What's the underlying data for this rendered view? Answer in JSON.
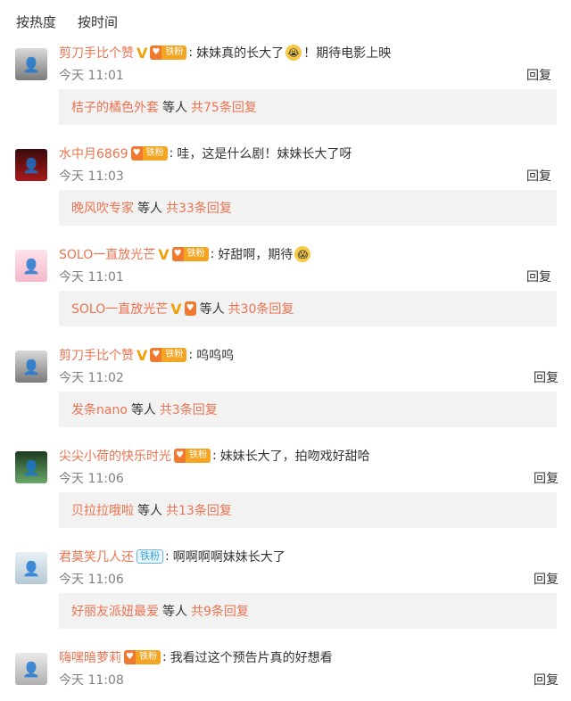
{
  "tabs": {
    "hot": "按热度",
    "time": "按时间"
  },
  "fan_badge": {
    "icon": "♥",
    "text": "铁粉"
  },
  "comments": [
    {
      "user": "剪刀手比个赞",
      "verified": true,
      "fan": true,
      "text": "妹妹真的长大了",
      "emoji": "😭",
      "after": "！期待电影上映",
      "time": "今天 11:01",
      "reply": "回复",
      "sub_user": "桔子的橘色外套",
      "sub_mid": "等人",
      "sub_count": "共75条回复"
    },
    {
      "user": "水中月6869",
      "verified": false,
      "fan": true,
      "text": "哇，这是什么剧！妹妹长大了呀",
      "emoji": "",
      "after": "",
      "time": "今天 11:03",
      "reply": "回复",
      "sub_user": "晚风吹专家",
      "sub_mid": "等人",
      "sub_count": "共33条回复"
    },
    {
      "user": "SOLO一直放光芒",
      "verified": true,
      "fan": true,
      "text": "好甜啊，期待",
      "emoji": "😱",
      "after": "",
      "time": "今天 11:01",
      "reply": "回复",
      "sub_user": "SOLO一直放光芒",
      "sub_mid": "等人",
      "sub_count": "共30条回复"
    },
    {
      "user": "剪刀手比个赞",
      "verified": true,
      "fan": true,
      "text": "呜呜呜",
      "emoji": "",
      "after": "",
      "time": "今天 11:02",
      "reply": "回复",
      "sub_user": "发条nano",
      "sub_mid": "等人",
      "sub_count": "共3条回复"
    },
    {
      "user": "尖尖小荷的快乐时光",
      "verified": false,
      "fan": true,
      "text": "妹妹长大了，拍吻戏好甜哈",
      "emoji": "",
      "after": "",
      "time": "今天 11:06",
      "reply": "回复",
      "sub_user": "贝拉拉哦啦",
      "sub_mid": "等人",
      "sub_count": "共13条回复"
    },
    {
      "user": "君莫笑几人还",
      "verified": false,
      "fan": true,
      "text": "啊啊啊啊妹妹长大了",
      "emoji": "",
      "after": "",
      "time": "今天 11:06",
      "reply": "回复",
      "sub_user": "好丽友派妞最爱",
      "sub_mid": "等人",
      "sub_count": "共9条回复"
    },
    {
      "user": "嗨嘿暗萝莉",
      "verified": false,
      "fan": true,
      "text": "我看过这个预告片真的好想看",
      "emoji": "",
      "after": "",
      "time": "今天 11:08",
      "reply": "回复",
      "sub_user": "",
      "sub_mid": "",
      "sub_count": ""
    }
  ],
  "colors": {
    "username": "#eb7350",
    "verified": "#f0a10a",
    "time": "#808080",
    "subbox_bg": "#f2f2f2"
  }
}
